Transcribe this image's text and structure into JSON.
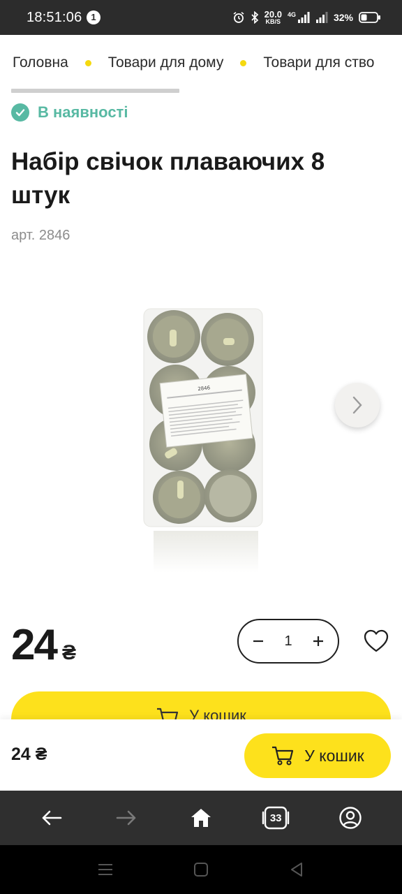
{
  "status_bar": {
    "time": "18:51:06",
    "notification_count": "1",
    "net_speed_value": "20.0",
    "net_speed_unit": "KB/S",
    "network_type": "4G",
    "battery_percent": "32%"
  },
  "breadcrumb": {
    "items": [
      "Головна",
      "Товари для дому",
      "Товари для ство"
    ]
  },
  "product": {
    "availability": "В наявності",
    "title": "Набір свічок плаваючих 8 штук",
    "sku": "арт. 2846",
    "price_value": "24",
    "currency": "₴",
    "quantity": "1",
    "add_to_cart": "У кошик",
    "package_label_code": "2846"
  },
  "sticky_bar": {
    "price": "24 ₴",
    "add_to_cart": "У кошик"
  },
  "browser_nav": {
    "tabs_count": "33"
  },
  "colors": {
    "accent_yellow": "#fde11c",
    "available_green": "#58b9a3",
    "status_bar_bg": "#2c2c2c",
    "browser_nav_bg": "#2f2f2f"
  }
}
